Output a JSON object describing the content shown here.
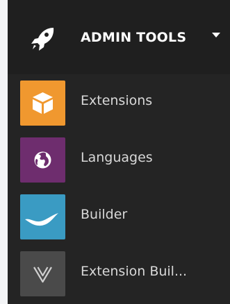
{
  "header": {
    "label": "ADMIN TOOLS",
    "icon": "rocket-icon",
    "toggle_icon": "caret-down-icon"
  },
  "items": [
    {
      "label": "Extensions",
      "icon": "package-icon",
      "color": "#f0982f"
    },
    {
      "label": "Languages",
      "icon": "globe-icon",
      "color": "#6e2d6e"
    },
    {
      "label": "Builder",
      "icon": "wave-icon",
      "color": "#3a9bc3"
    },
    {
      "label": "Extension Buil...",
      "icon": "vue-icon",
      "color": "#4a4a4a"
    }
  ]
}
